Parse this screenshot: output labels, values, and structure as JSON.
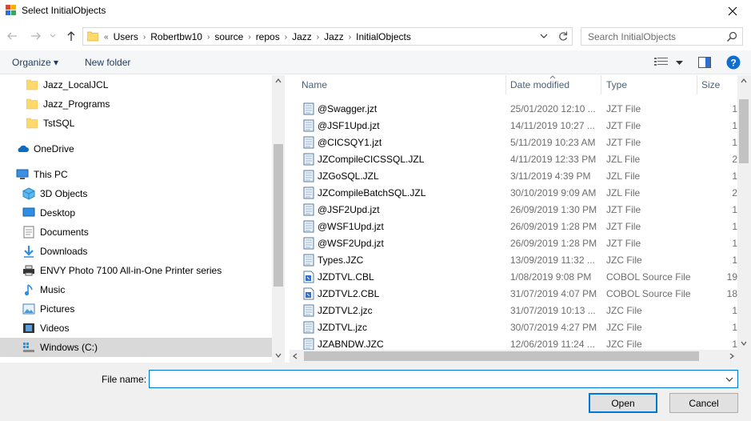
{
  "window": {
    "title": "Select InitialObjects"
  },
  "address": {
    "overflow": "«",
    "crumbs": [
      "Users",
      "Robertbw10",
      "source",
      "repos",
      "Jazz",
      "Jazz",
      "InitialObjects"
    ]
  },
  "search": {
    "placeholder": "Search InitialObjects"
  },
  "toolbar": {
    "organize": "Organize ▾",
    "new_folder": "New folder",
    "help": "?"
  },
  "sidebar": {
    "items": [
      {
        "label": "Jazz_LocalJCL",
        "icon": "folder-icon"
      },
      {
        "label": "Jazz_Programs",
        "icon": "folder-icon"
      },
      {
        "label": "TstSQL",
        "icon": "folder-icon"
      },
      {
        "label": "OneDrive",
        "icon": "cloud-icon"
      },
      {
        "label": "This PC",
        "icon": "computer-icon"
      },
      {
        "label": "3D Objects",
        "icon": "cube-icon"
      },
      {
        "label": "Desktop",
        "icon": "desktop-icon"
      },
      {
        "label": "Documents",
        "icon": "documents-icon"
      },
      {
        "label": "Downloads",
        "icon": "download-icon"
      },
      {
        "label": "ENVY Photo 7100 All-in-One Printer series",
        "icon": "printer-icon"
      },
      {
        "label": "Music",
        "icon": "music-icon"
      },
      {
        "label": "Pictures",
        "icon": "pictures-icon"
      },
      {
        "label": "Videos",
        "icon": "videos-icon"
      },
      {
        "label": "Windows (C:)",
        "icon": "drive-icon"
      }
    ]
  },
  "columns": {
    "name": "Name",
    "date": "Date modified",
    "type": "Type",
    "size": "Size"
  },
  "files": [
    {
      "name": "@Swagger.jzt",
      "date": "25/01/2020 12:10 ...",
      "type": "JZT File",
      "size": "1",
      "icon": "file-icon"
    },
    {
      "name": "@JSF1Upd.jzt",
      "date": "14/11/2019 10:27 ...",
      "type": "JZT File",
      "size": "1",
      "icon": "file-icon"
    },
    {
      "name": "@CICSQY1.jzt",
      "date": "5/11/2019 10:23 AM",
      "type": "JZT File",
      "size": "1",
      "icon": "file-icon"
    },
    {
      "name": "JZCompileCICSSQL.JZL",
      "date": "4/11/2019 12:33 PM",
      "type": "JZL File",
      "size": "2",
      "icon": "file-icon"
    },
    {
      "name": "JZGoSQL.JZL",
      "date": "3/11/2019 4:39 PM",
      "type": "JZL File",
      "size": "1",
      "icon": "file-icon"
    },
    {
      "name": "JZCompileBatchSQL.JZL",
      "date": "30/10/2019 9:09 AM",
      "type": "JZL File",
      "size": "2",
      "icon": "file-icon"
    },
    {
      "name": "@JSF2Upd.jzt",
      "date": "26/09/2019 1:30 PM",
      "type": "JZT File",
      "size": "1",
      "icon": "file-icon"
    },
    {
      "name": "@WSF1Upd.jzt",
      "date": "26/09/2019 1:28 PM",
      "type": "JZT File",
      "size": "1",
      "icon": "file-icon"
    },
    {
      "name": "@WSF2Upd.jzt",
      "date": "26/09/2019 1:28 PM",
      "type": "JZT File",
      "size": "1",
      "icon": "file-icon"
    },
    {
      "name": "Types.JZC",
      "date": "13/09/2019 11:32 ...",
      "type": "JZC File",
      "size": "1",
      "icon": "file-icon"
    },
    {
      "name": "JZDTVL.CBL",
      "date": "1/08/2019 9:08 PM",
      "type": "COBOL Source File",
      "size": "19",
      "icon": "cobol-file-icon"
    },
    {
      "name": "JZDTVL2.CBL",
      "date": "31/07/2019 4:07 PM",
      "type": "COBOL Source File",
      "size": "18",
      "icon": "cobol-file-icon"
    },
    {
      "name": "JZDTVL2.jzc",
      "date": "31/07/2019 10:13 ...",
      "type": "JZC File",
      "size": "1",
      "icon": "file-icon"
    },
    {
      "name": "JZDTVL.jzc",
      "date": "30/07/2019 4:27 PM",
      "type": "JZC File",
      "size": "1",
      "icon": "file-icon"
    },
    {
      "name": "JZABNDW.JZC",
      "date": "12/06/2019 11:24 ...",
      "type": "JZC File",
      "size": "1",
      "icon": "file-icon"
    }
  ],
  "footer": {
    "file_name_label": "File name:",
    "file_name_value": "",
    "open": "Open",
    "cancel": "Cancel"
  },
  "colors": {
    "accent": "#0078d7",
    "selected": "#d9d9d9",
    "folder": "#ffd96b",
    "link": "#1e395b"
  }
}
